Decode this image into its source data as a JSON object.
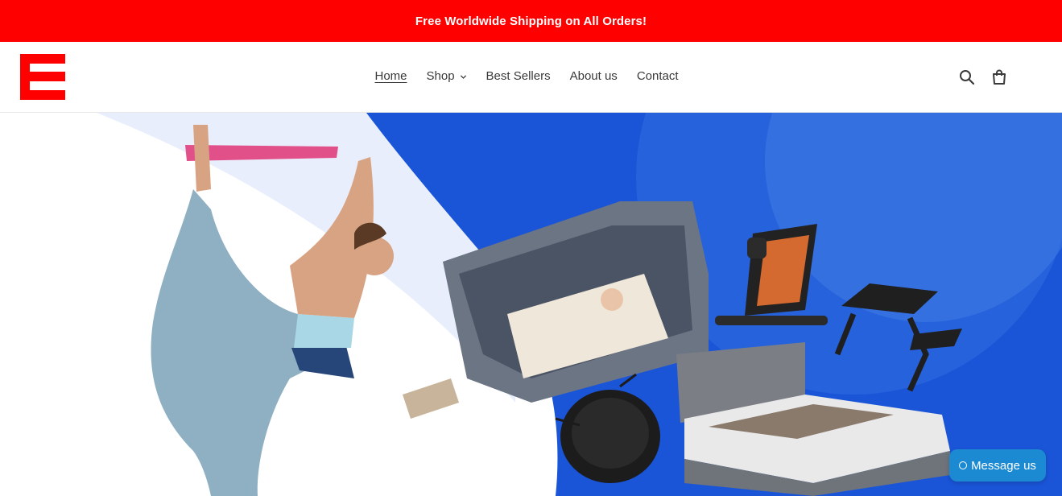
{
  "announcement": {
    "text": "Free Worldwide Shipping on All Orders!"
  },
  "header": {
    "logo_icon": "store-logo-e",
    "nav": [
      {
        "label": "Home",
        "active": true
      },
      {
        "label": "Shop",
        "has_dropdown": true
      },
      {
        "label": "Best Sellers"
      },
      {
        "label": "About us"
      },
      {
        "label": "Contact"
      }
    ],
    "icons": {
      "search": "search-icon",
      "cart": "cart-icon"
    }
  },
  "colors": {
    "announcement_bg": "#ff0000",
    "hero_blue": "#1a55d8",
    "chat_bg": "#1c8ad2"
  },
  "chat": {
    "label": "Message us"
  }
}
